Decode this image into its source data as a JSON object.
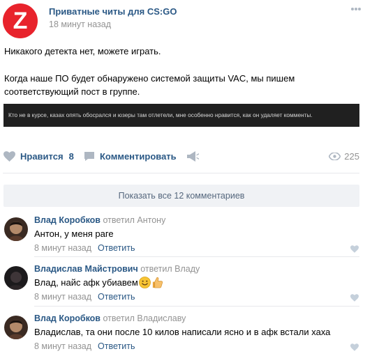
{
  "post": {
    "group_name": "Приватные читы для CS:GO",
    "time": "18 минут назад",
    "avatar_letter": "Z",
    "text_line1": "Никакого детекта нет, можете играть.",
    "text_line2": "Когда наше ПО будет обнаружено системой защиты VAC, мы пишем соответствующий пост в группе.",
    "banner_text": "Кто не в курсе, казах опять обосрался и юзеры там отлетели, мне особенно нравится, как он удаляет комменты."
  },
  "actions": {
    "like_label": "Нравится",
    "like_count": "8",
    "comment_label": "Комментировать",
    "views_count": "225",
    "icons": [
      "heart-icon",
      "comment-icon",
      "share-icon",
      "eye-icon"
    ]
  },
  "show_all_label": "Показать все 12 комментариев",
  "comments": [
    {
      "author": "Влад Коробков",
      "reply_to": "ответил Антону",
      "text": "Антон, у меня раге",
      "time": "8 минут назад",
      "reply_label": "Ответить"
    },
    {
      "author": "Владислав Майстрович",
      "reply_to": "ответил Владу",
      "text": "Влад, найс афк убиавем",
      "emojis": [
        "smile-emoji",
        "thumbs-up-emoji"
      ],
      "time": "8 минут назад",
      "reply_label": "Ответить"
    },
    {
      "author": "Влад Коробков",
      "reply_to": "ответил Владиславу",
      "text": "Владислав, та они после 10 килов написали ясно и в афк встали хаха",
      "time": "8 минут назад",
      "reply_label": "Ответить"
    }
  ],
  "colors": {
    "link": "#2a5885",
    "muted": "#939393",
    "icon": "#aeb7c2",
    "logo_red": "#e8232c",
    "banner_bg": "#202020",
    "show_all_bg": "#f0f2f5"
  }
}
